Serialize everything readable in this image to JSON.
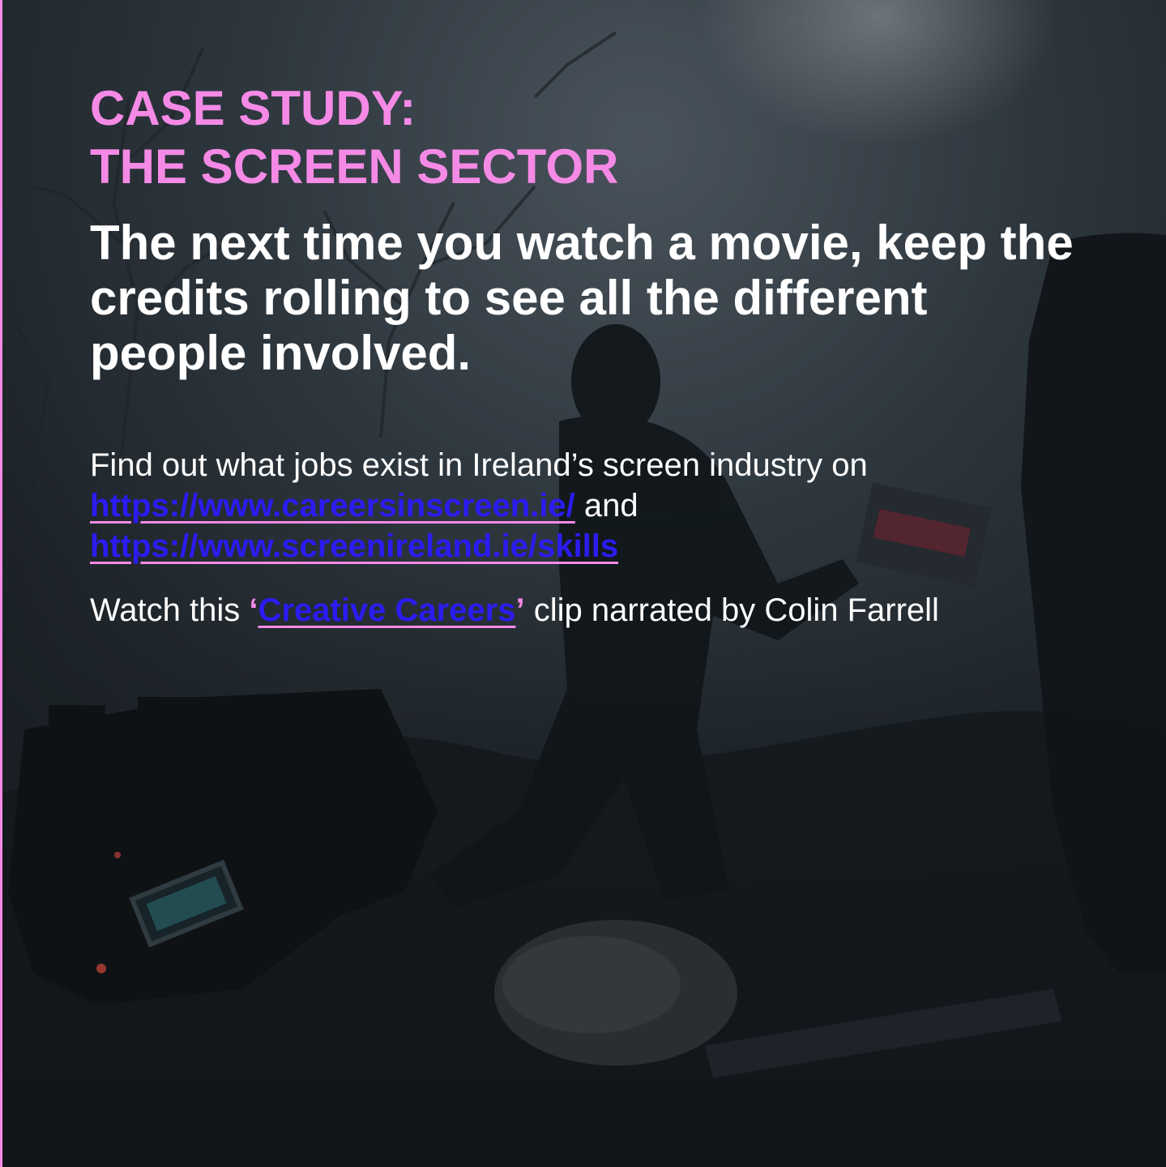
{
  "theme": {
    "accent": "#f58ae6",
    "text": "#ffffff",
    "link": "#2b1cf0",
    "background": "#1c2227"
  },
  "title": {
    "line1": "CASE STUDY:",
    "line2": "THE SCREEN SECTOR"
  },
  "headline": "The next time you watch a movie, keep the credits rolling to see all the different people involved.",
  "find_out": {
    "intro": "Find out what jobs exist in Ireland’s screen industry on",
    "link1": "https://www.careersinscreen.ie/",
    "conjunction": " and",
    "link2": "https://www.screenireland.ie/skills"
  },
  "watch": {
    "prefix": "Watch this ",
    "open_quote": "‘",
    "link": "Creative Careers",
    "close_quote": "’",
    "suffix": " clip narrated by Colin Farrell"
  }
}
